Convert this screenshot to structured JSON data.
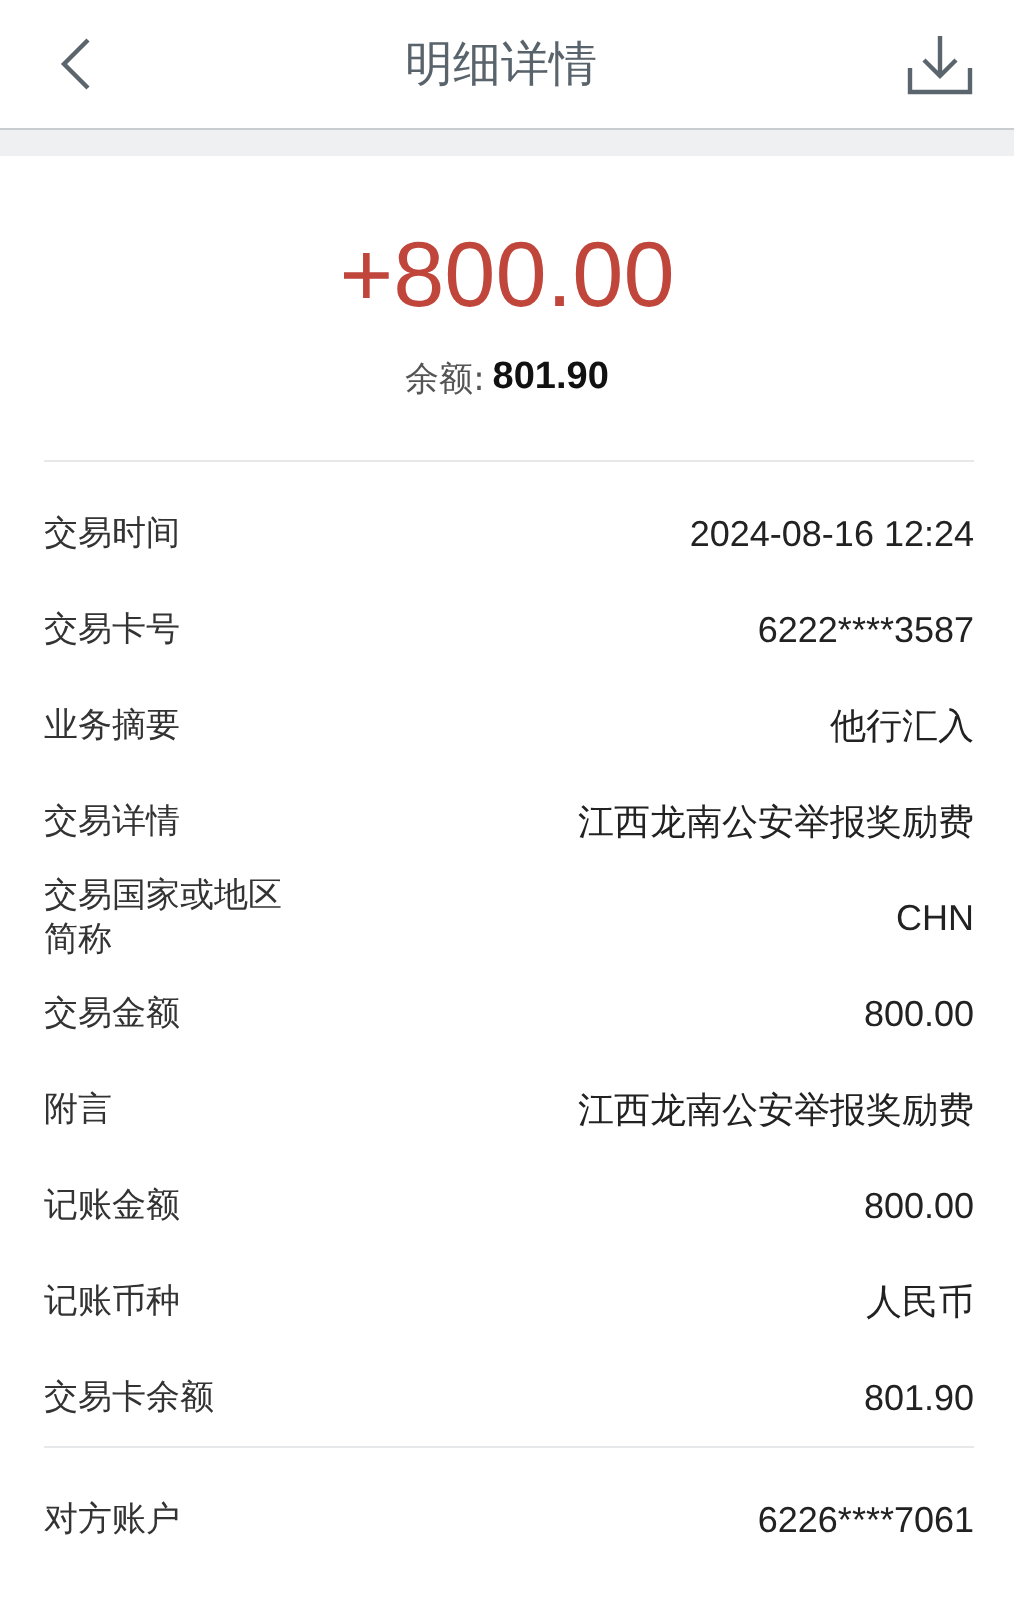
{
  "header": {
    "title": "明细详情"
  },
  "summary": {
    "amount": "+800.00",
    "balance_label": "余额:",
    "balance": "801.90"
  },
  "sections": [
    {
      "rows": [
        {
          "label": "交易时间",
          "value": "2024-08-16 12:24"
        },
        {
          "label": "交易卡号",
          "value": "6222****3587"
        },
        {
          "label": "业务摘要",
          "value": "他行汇入"
        },
        {
          "label": "交易详情",
          "value": "江西龙南公安举报奖励费"
        },
        {
          "label": "交易国家或地区简称",
          "value": "CHN"
        },
        {
          "label": "交易金额",
          "value": "800.00"
        },
        {
          "label": "附言",
          "value": "江西龙南公安举报奖励费"
        },
        {
          "label": "记账金额",
          "value": "800.00"
        },
        {
          "label": "记账币种",
          "value": "人民币"
        },
        {
          "label": "交易卡余额",
          "value": "801.90"
        }
      ]
    },
    {
      "rows": [
        {
          "label": "对方账户",
          "value": "6226****7061"
        }
      ]
    }
  ]
}
